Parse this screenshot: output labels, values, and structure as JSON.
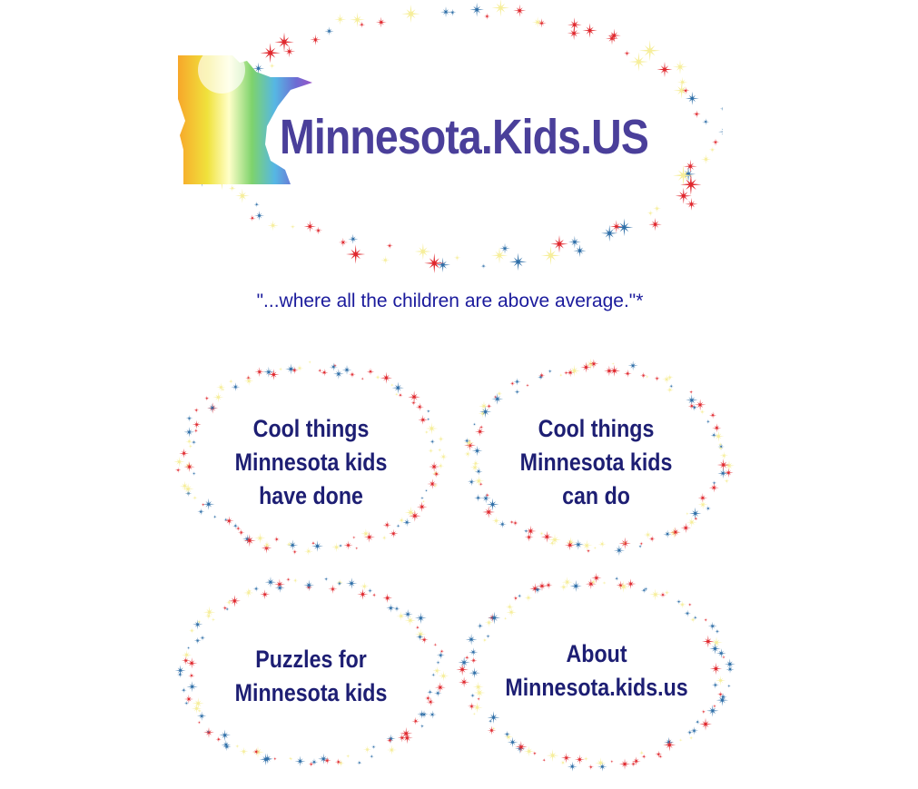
{
  "header": {
    "site_name": "Minnesota.Kids.US",
    "tagline": "\"...where all the children are above average.\"*"
  },
  "nav": {
    "cool_done": "Cool things\nMinnesota kids\nhave done",
    "cool_can_do": "Cool things\nMinnesota kids\ncan do",
    "puzzles": "Puzzles for\nMinnesota kids",
    "about": "About\nMinnesota.kids.us"
  },
  "colors": {
    "star_red": "#e0282e",
    "star_blue": "#2f6fa8",
    "star_yellow": "#f6ee9a",
    "text_navy": "#1d1e73",
    "logo_purple": "#4a3f9a"
  },
  "icons": {
    "logo": "minnesota-rainbow-map-icon",
    "decoration": "sparkle-star-icon"
  }
}
